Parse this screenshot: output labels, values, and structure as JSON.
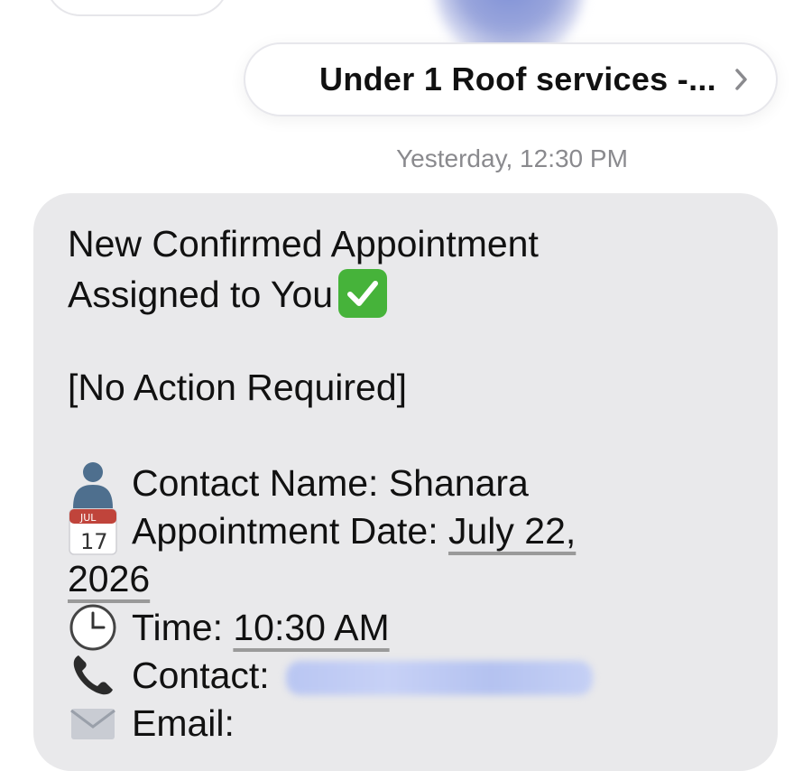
{
  "header": {
    "contact_pill_label": "Under 1 Roof services -...",
    "chevron_icon": "chevron-right-icon"
  },
  "thread": {
    "timestamp": "Yesterday, 12:30 PM"
  },
  "message": {
    "title_line1": "New Confirmed Appointment",
    "title_line2": "Assigned to You",
    "title_emoji": "check-mark-button-icon",
    "note": "[No Action Required]",
    "contact_name_label": "Contact Name: Shanara",
    "appointment_date_label": "Appointment Date: ",
    "appointment_date_part1": "July 22,",
    "appointment_date_part2": "2026",
    "calendar_icon_month": "JUL",
    "calendar_icon_day": "17",
    "time_label": "Time: ",
    "time_value": "10:30 AM",
    "contact_label": "Contact:",
    "email_label": "Email:"
  },
  "colors": {
    "bubble": "#e9e9eb",
    "emoji_green": "#46b33a",
    "timestamp": "#8a8a8e"
  }
}
